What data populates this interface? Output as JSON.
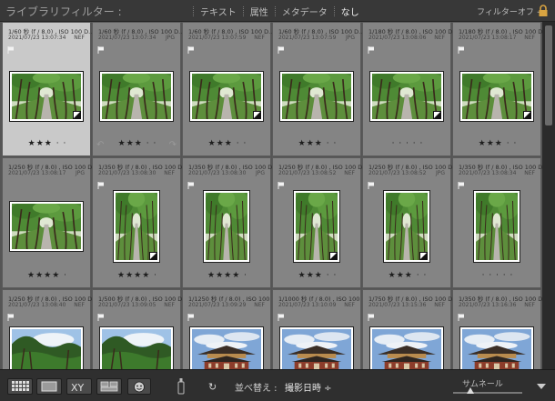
{
  "filter_bar": {
    "title": "ライブラリフィルター :",
    "tabs": [
      {
        "label": "テキスト",
        "active": false
      },
      {
        "label": "属性",
        "active": false
      },
      {
        "label": "メタデータ",
        "active": false
      },
      {
        "label": "なし",
        "active": true
      }
    ],
    "preset": "フィルターオフ ÷"
  },
  "grid": {
    "cells": [
      {
        "id": "c0",
        "meta1": "1/60 秒 (f / 8.0) , ISO 100  D...",
        "meta2": "2021/07/23 13:07:34",
        "ftype": "NEF",
        "stars": "★★★ · ·",
        "scene": "forest",
        "orient": "landscape",
        "badge": true,
        "selected": true,
        "rotate": false,
        "flag": true
      },
      {
        "id": "c1",
        "meta1": "1/60 秒 (f / 8.0) , ISO 100  D...",
        "meta2": "2021/07/23 13:07:34",
        "ftype": "JPG",
        "stars": "★★★ · ·",
        "scene": "forest",
        "orient": "landscape",
        "badge": false,
        "selected": false,
        "rotate": true,
        "flag": true
      },
      {
        "id": "c2",
        "meta1": "1/60 秒 (f / 8.0) , ISO 100  D...",
        "meta2": "2021/07/23 13:07:59",
        "ftype": "NEF",
        "stars": "★★★ · ·",
        "scene": "forest",
        "orient": "landscape",
        "badge": true,
        "selected": false,
        "rotate": false,
        "flag": true
      },
      {
        "id": "c3",
        "meta1": "1/60 秒 (f / 8.0) , ISO 100  D...",
        "meta2": "2021/07/23 13:07:59",
        "ftype": "JPG",
        "stars": "★★★ · ·",
        "scene": "forest",
        "orient": "landscape",
        "badge": false,
        "selected": false,
        "rotate": false,
        "flag": true
      },
      {
        "id": "c4",
        "meta1": "1/180 秒 (f / 8.0) , ISO 100  D...",
        "meta2": "2021/07/23 13:08:06",
        "ftype": "NEF",
        "stars": "· · · · ·",
        "scene": "forest",
        "orient": "landscape",
        "badge": true,
        "selected": false,
        "rotate": false,
        "flag": true
      },
      {
        "id": "c5",
        "meta1": "1/180 秒 (f / 8.0) , ISO 100  D...",
        "meta2": "2021/07/23 13:08:17",
        "ftype": "NEF",
        "stars": "★★★ · ·",
        "scene": "forest",
        "orient": "landscape",
        "badge": true,
        "selected": false,
        "rotate": false,
        "flag": true
      },
      {
        "id": "c6",
        "meta1": "1/250 秒 (f / 8.0) , ISO 100  D...",
        "meta2": "2021/07/23 13:08:17",
        "ftype": "JPG",
        "stars": "★★★★ ·",
        "scene": "forest",
        "orient": "landscape",
        "badge": false,
        "selected": false,
        "rotate": false,
        "flag": false
      },
      {
        "id": "c7",
        "meta1": "1/350 秒 (f / 8.0) , ISO 100  D...",
        "meta2": "2021/07/23 13:08:30",
        "ftype": "NEF",
        "stars": "★★★★ ·",
        "scene": "forest",
        "orient": "portrait",
        "badge": true,
        "selected": false,
        "rotate": false,
        "flag": true
      },
      {
        "id": "c8",
        "meta1": "1/350 秒 (f / 8.0) , ISO 100  D...",
        "meta2": "2021/07/23 13:08:30",
        "ftype": "JPG",
        "stars": "★★★★ ·",
        "scene": "forest",
        "orient": "portrait",
        "badge": false,
        "selected": false,
        "rotate": false,
        "flag": true
      },
      {
        "id": "c9",
        "meta1": "1/250 秒 (f / 8.0) , ISO 100  D...",
        "meta2": "2021/07/23 13:08:52",
        "ftype": "NEF",
        "stars": "★★★ · ·",
        "scene": "forest",
        "orient": "portrait",
        "badge": true,
        "selected": false,
        "rotate": false,
        "flag": true
      },
      {
        "id": "c10",
        "meta1": "1/250 秒 (f / 8.0) , ISO 100  D...",
        "meta2": "2021/07/23 13:08:52",
        "ftype": "JPG",
        "stars": "★★★ · ·",
        "scene": "forest",
        "orient": "portrait",
        "badge": true,
        "selected": false,
        "rotate": false,
        "flag": true
      },
      {
        "id": "c11",
        "meta1": "1/350 秒 (f / 8.0) , ISO 100  D...",
        "meta2": "2021/07/23 13:08:34",
        "ftype": "NEF",
        "stars": "· · · · ·",
        "scene": "forest",
        "orient": "portrait",
        "badge": false,
        "selected": false,
        "rotate": false,
        "flag": true
      },
      {
        "id": "c12",
        "meta1": "1/250 秒 (f / 8.0) , ISO 100  D...",
        "meta2": "2021/07/23 13:08:40",
        "ftype": "NEF",
        "stars": "",
        "scene": "forest2",
        "orient": "landscape",
        "badge": false,
        "selected": false,
        "rotate": false,
        "flag": true
      },
      {
        "id": "c13",
        "meta1": "1/500 秒 (f / 8.0) , ISO 100 D...",
        "meta2": "2021/07/23 13:09:05",
        "ftype": "NEF",
        "stars": "",
        "scene": "forest2",
        "orient": "landscape",
        "badge": false,
        "selected": false,
        "rotate": false,
        "flag": true
      },
      {
        "id": "c14",
        "meta1": "1/1250 秒 (f / 8.0) , ISO 100",
        "meta2": "2021/07/23 13:09:29",
        "ftype": "NEF",
        "stars": "",
        "scene": "temple",
        "orient": "landscape",
        "badge": false,
        "selected": false,
        "rotate": false,
        "flag": true
      },
      {
        "id": "c15",
        "meta1": "1/1000 秒 (f / 8.0) , ISO 100 D...",
        "meta2": "2021/07/23 13:10:09",
        "ftype": "NEF",
        "stars": "",
        "scene": "temple",
        "orient": "landscape",
        "badge": false,
        "selected": false,
        "rotate": false,
        "flag": true
      },
      {
        "id": "c16",
        "meta1": "1/750 秒 (f / 8.0) , ISO 100 D...",
        "meta2": "2021/07/23 13:15:36",
        "ftype": "NEF",
        "stars": "",
        "scene": "temple",
        "orient": "landscape",
        "badge": false,
        "selected": false,
        "rotate": false,
        "flag": true
      },
      {
        "id": "c17",
        "meta1": "1/350 秒 (f / 8.0) , ISO 100 D...",
        "meta2": "2021/07/23 13:16:36",
        "ftype": "NEF",
        "stars": "",
        "scene": "temple",
        "orient": "landscape",
        "badge": false,
        "selected": false,
        "rotate": false,
        "flag": true
      }
    ]
  },
  "toolbar": {
    "view_buttons": [
      {
        "name": "grid-view-button",
        "icon": "grid-icon"
      },
      {
        "name": "loupe-view-button",
        "icon": "loupe-icon"
      },
      {
        "name": "compare-view-button",
        "icon": "xy-compare-icon",
        "text": "XY"
      },
      {
        "name": "survey-view-button",
        "icon": "survey-icon"
      },
      {
        "name": "people-view-button",
        "icon": "people-icon"
      }
    ],
    "sort_label": "並べ替え :",
    "sort_value": "撮影日時 ÷",
    "thumb_label": "サムネール",
    "thumb_size": 0.25
  }
}
